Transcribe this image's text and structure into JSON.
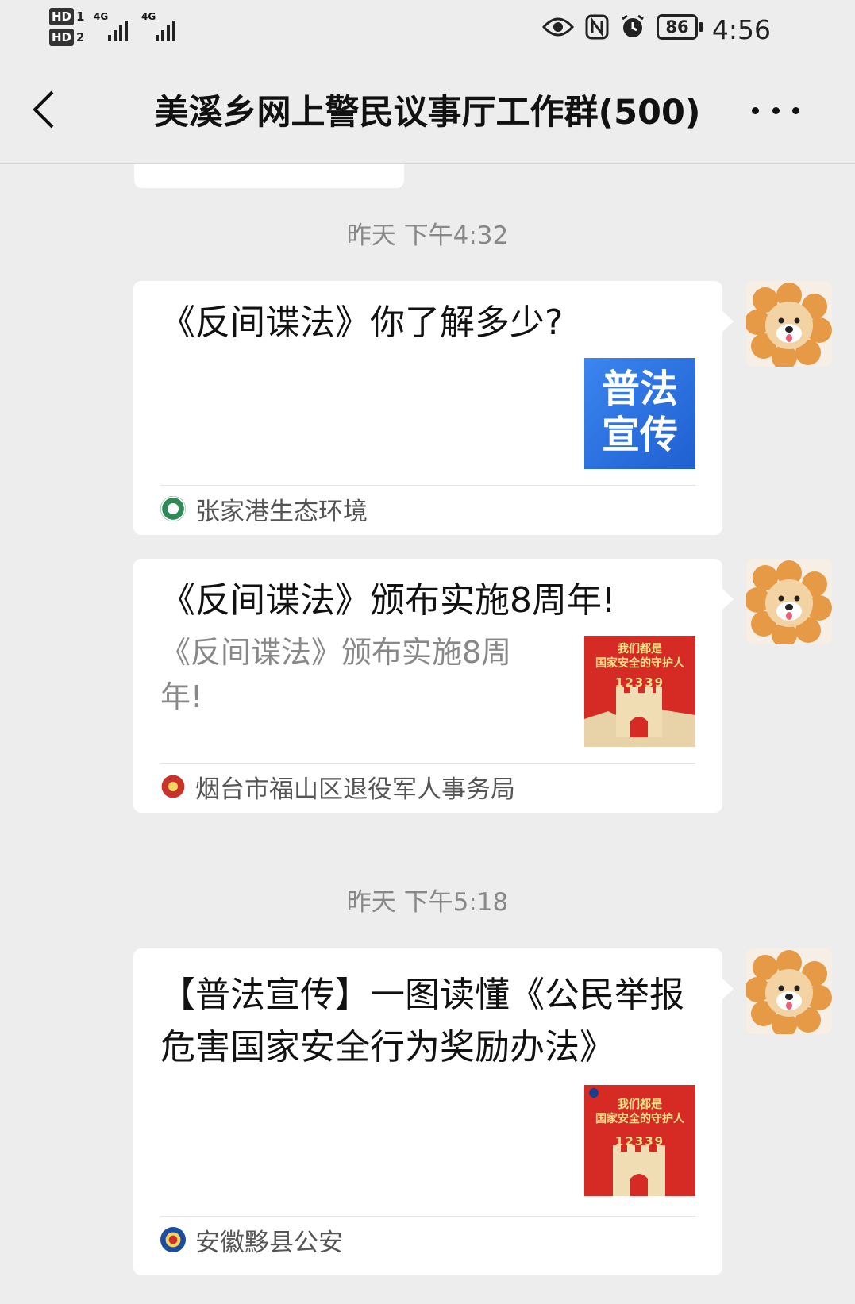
{
  "status_bar": {
    "sim1_label": "HD",
    "sim1_num": "1",
    "sim2_label": "HD",
    "sim2_num": "2",
    "network1": "4G",
    "network2": "4G",
    "battery": "86",
    "time": "4:56"
  },
  "header": {
    "title": "美溪乡网上警民议事厅工作群(500)"
  },
  "messages": [
    {
      "timestamp": "昨天 下午4:32",
      "title": "《反间谍法》你了解多少?",
      "description": "",
      "thumb_text": "普法宣传",
      "thumb_line1": "普法",
      "thumb_line2": "宣传",
      "source": "张家港生态环境"
    },
    {
      "title": "《反间谍法》颁布实施8周年!",
      "description": "《反间谍法》颁布实施8周年!",
      "thumb_line1": "我们都是",
      "thumb_line2": "国家安全的守护人",
      "thumb_number": "12339",
      "source": "烟台市福山区退役军人事务局"
    },
    {
      "timestamp": "昨天 下午5:18",
      "title": "【普法宣传】一图读懂《公民举报危害国家安全行为奖励办法》",
      "description": "",
      "thumb_line1": "我们都是",
      "thumb_line2": "国家安全的守护人",
      "thumb_number": "12339",
      "source": "安徽黟县公安"
    }
  ],
  "colors": {
    "background": "#ededed",
    "card": "#ffffff",
    "thumb_blue": "#2f73e0",
    "thumb_red": "#d62b24"
  }
}
